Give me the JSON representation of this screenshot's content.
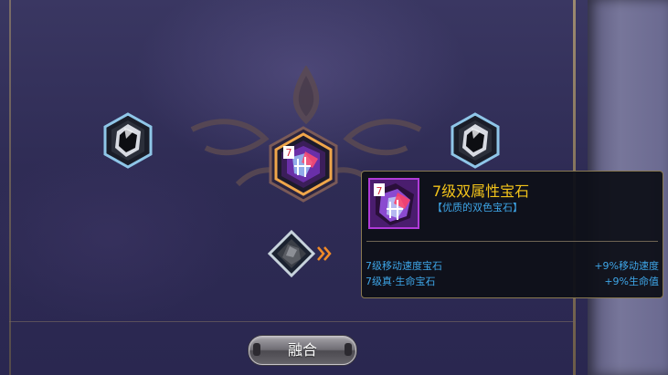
{
  "colors": {
    "title_gold": "#f2c31a",
    "stat_blue": "#3ea6e8",
    "tooltip_border": "#8a7a52"
  },
  "slots": [
    {
      "name": "left-input-gem",
      "icon": "dark-crystal-icon",
      "state": "filled"
    },
    {
      "name": "center-result-gem",
      "icon": "dual-attribute-gem-icon",
      "state": "result",
      "level_badge": "7"
    },
    {
      "name": "right-input-gem",
      "icon": "dark-crystal-icon",
      "state": "filled"
    },
    {
      "name": "material-gem",
      "icon": "dark-ore-icon",
      "state": "material"
    }
  ],
  "tooltip": {
    "level_badge": "7",
    "title": "7级双属性宝石",
    "subtitle": "【优质的双色宝石】",
    "rows": [
      {
        "label": "7级移动速度宝石",
        "value": "+9%移动速度"
      },
      {
        "label": "7级真·生命宝石",
        "value": "+9%生命值"
      }
    ]
  },
  "fuse_button": {
    "label": "融合"
  }
}
